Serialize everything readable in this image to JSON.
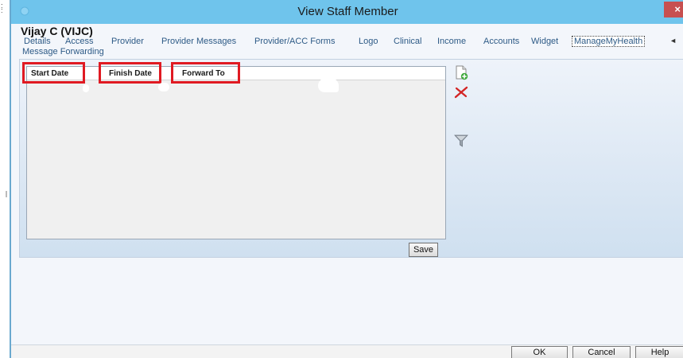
{
  "window": {
    "title": "View Staff Member",
    "close_label": "×"
  },
  "heading": "Vijay C (VIJC)",
  "tabs": [
    {
      "label": "Details"
    },
    {
      "label": "Access"
    },
    {
      "label": "Provider"
    },
    {
      "label": "Provider Messages"
    },
    {
      "label": "Provider/ACC Forms"
    },
    {
      "label": "Logo"
    },
    {
      "label": "Clinical"
    },
    {
      "label": "Income"
    },
    {
      "label": "Accounts"
    },
    {
      "label": "Widget"
    },
    {
      "label": "ManageMyHealth",
      "active": true
    }
  ],
  "tab_scroll_label": "◄",
  "subtab": "Message Forwarding",
  "grid": {
    "columns": [
      "Start Date",
      "Finish Date",
      "Forward To"
    ],
    "rows": []
  },
  "save_label": "Save",
  "toolbar_icons": [
    "add-document-icon",
    "delete-icon",
    "filter-icon"
  ],
  "footer": {
    "ok_label": "OK",
    "cancel_label": "Cancel",
    "help_label": "Help"
  },
  "colors": {
    "titlebar": "#6fc4ec",
    "highlight": "#e01a22",
    "link": "#2d5a86"
  }
}
